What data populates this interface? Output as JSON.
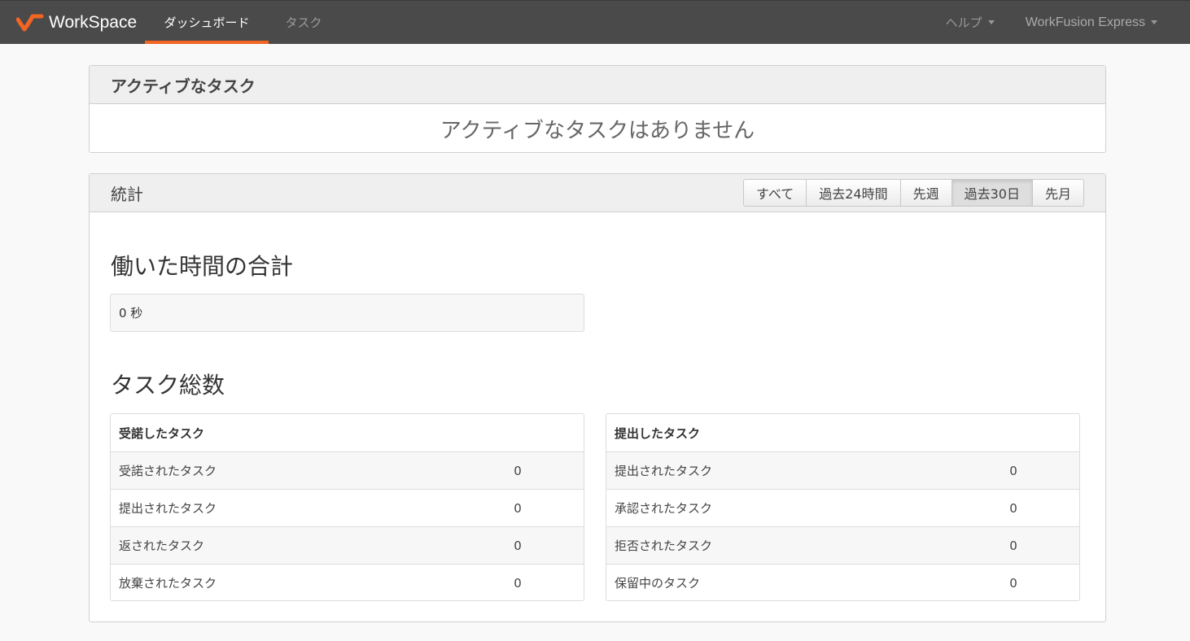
{
  "navbar": {
    "brand": "WorkSpace",
    "items": [
      {
        "label": "ダッシュボード",
        "active": true
      },
      {
        "label": "タスク",
        "active": false
      }
    ],
    "help": "ヘルプ",
    "user": "WorkFusion Express",
    "accent": "#f26522"
  },
  "active_tasks": {
    "title": "アクティブなタスク",
    "empty_message": "アクティブなタスクはありません"
  },
  "stats": {
    "title": "統計",
    "filters": [
      {
        "label": "すべて",
        "active": false
      },
      {
        "label": "過去24時間",
        "active": false
      },
      {
        "label": "先週",
        "active": false
      },
      {
        "label": "過去30日",
        "active": true
      },
      {
        "label": "先月",
        "active": false
      }
    ],
    "time_title": "働いた時間の合計",
    "time_value": "0 秒",
    "count_title": "タスク総数",
    "accepted": {
      "header": "受諾したタスク",
      "rows": [
        {
          "label": "受諾されたタスク",
          "value": "0"
        },
        {
          "label": "提出されたタスク",
          "value": "0"
        },
        {
          "label": "返されたタスク",
          "value": "0"
        },
        {
          "label": "放棄されたタスク",
          "value": "0"
        }
      ]
    },
    "submitted": {
      "header": "提出したタスク",
      "rows": [
        {
          "label": "提出されたタスク",
          "value": "0"
        },
        {
          "label": "承認されたタスク",
          "value": "0"
        },
        {
          "label": "拒否されたタスク",
          "value": "0"
        },
        {
          "label": "保留中のタスク",
          "value": "0"
        }
      ]
    }
  }
}
